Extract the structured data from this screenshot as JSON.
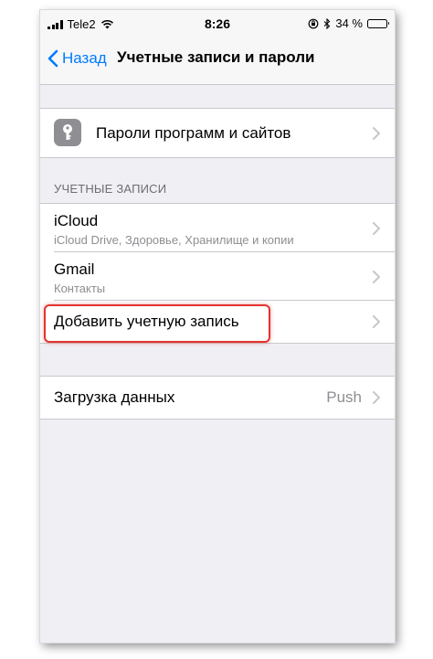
{
  "status_bar": {
    "carrier": "Tele2",
    "time": "8:26",
    "battery": "34 %",
    "battery_level": 0.34
  },
  "nav": {
    "back_label": "Назад",
    "title": "Учетные записи и пароли"
  },
  "passwords_row": {
    "label": "Пароли программ и сайтов",
    "icon": "key-icon"
  },
  "accounts_section": {
    "header": "УЧЕТНЫЕ ЗАПИСИ",
    "items": [
      {
        "title": "iCloud",
        "subtitle": "iCloud Drive, Здоровье, Хранилище и копии"
      },
      {
        "title": "Gmail",
        "subtitle": "Контакты"
      }
    ],
    "add_label": "Добавить учетную запись"
  },
  "fetch_row": {
    "label": "Загрузка данных",
    "value": "Push"
  },
  "colors": {
    "accent": "#007aff",
    "highlight": "#e3342f"
  }
}
